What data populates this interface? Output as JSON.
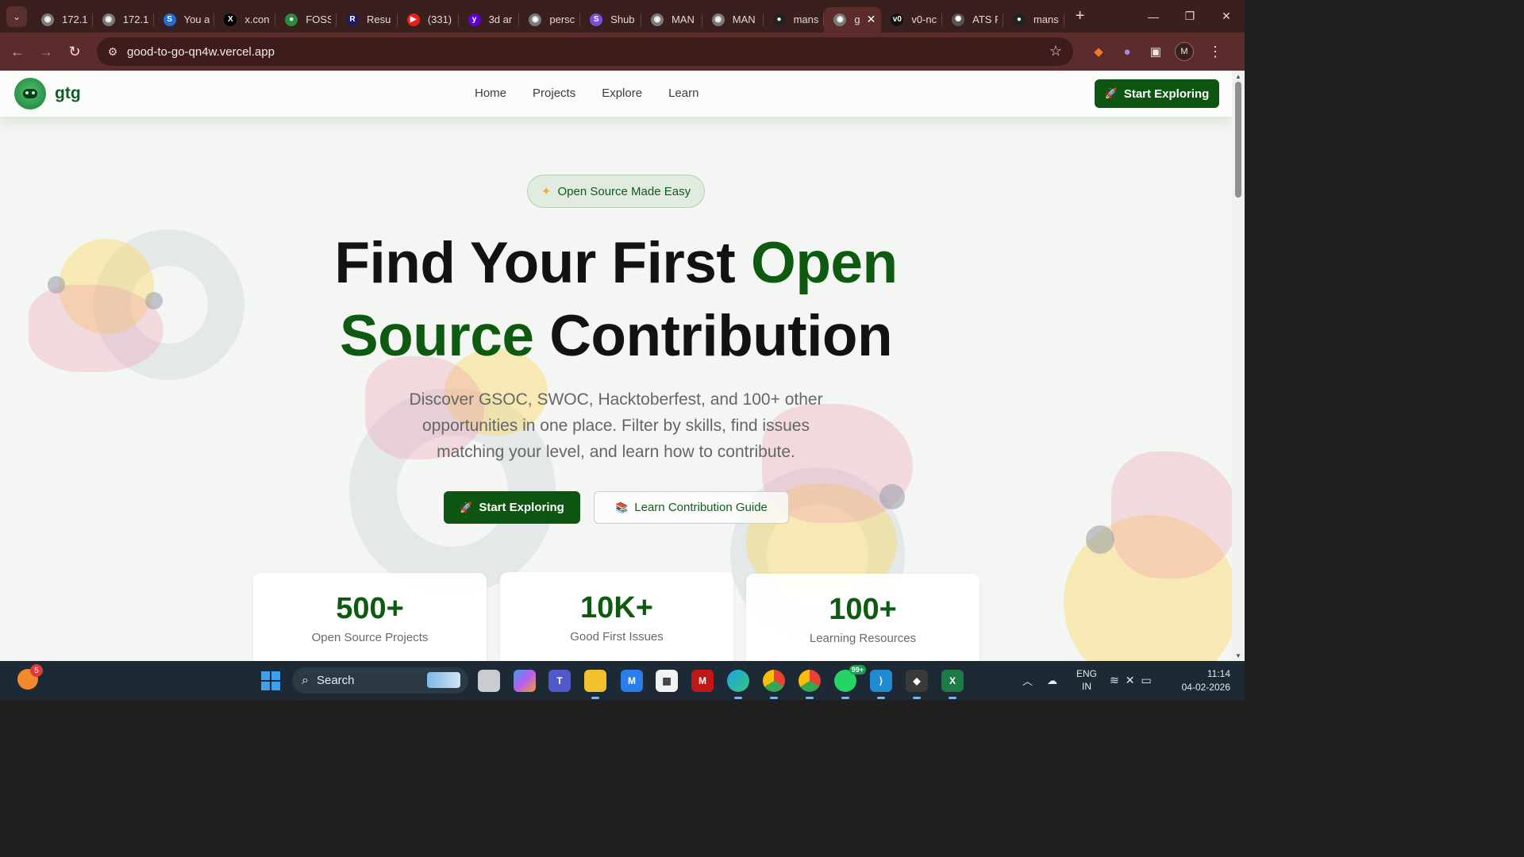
{
  "browser": {
    "tabs": [
      {
        "title": "172.1",
        "icon": "globe-icon",
        "color": "#7a7a7a"
      },
      {
        "title": "172.1",
        "icon": "globe-icon",
        "color": "#7a7a7a"
      },
      {
        "title": "You a",
        "icon": "s-logo-icon",
        "color": "#1f6fd6"
      },
      {
        "title": "x.con",
        "icon": "x-logo-icon",
        "color": "#000000"
      },
      {
        "title": "FOSS",
        "icon": "foss-logo-icon",
        "color": "#2b8a3e"
      },
      {
        "title": "Resu",
        "icon": "r-logo-icon",
        "color": "#1d1d5e"
      },
      {
        "title": "(331)",
        "icon": "youtube-icon",
        "color": "#e62117"
      },
      {
        "title": "3d ar",
        "icon": "yahoo-icon",
        "color": "#6001d2"
      },
      {
        "title": "persc",
        "icon": "globe-icon",
        "color": "#7a7a7a"
      },
      {
        "title": "Shub",
        "icon": "s-circle-icon",
        "color": "#7b4fd6"
      },
      {
        "title": "MAN",
        "icon": "globe-icon",
        "color": "#7a7a7a"
      },
      {
        "title": "MAN",
        "icon": "globe-icon",
        "color": "#7a7a7a"
      },
      {
        "title": "mans",
        "icon": "github-icon",
        "color": "#222222"
      },
      {
        "title": "g",
        "icon": "globe-icon",
        "color": "#7a7a7a",
        "active": true
      },
      {
        "title": "v0-nc",
        "icon": "v0-icon",
        "color": "#111111"
      },
      {
        "title": "ATS F",
        "icon": "openai-icon",
        "color": "#555555"
      },
      {
        "title": "mans",
        "icon": "github-icon",
        "color": "#222222"
      }
    ],
    "new_tab_label": "+",
    "url": "good-to-go-qn4w.vercel.app",
    "profile_initial": "M",
    "window": {
      "minimize": "—",
      "restore": "❐",
      "close": "✕"
    }
  },
  "site": {
    "logo_text": "gtg",
    "nav": [
      "Home",
      "Projects",
      "Explore",
      "Learn"
    ],
    "header_cta": "Start Exploring",
    "badge": "Open Source Made Easy",
    "hero": {
      "line1_dark": "Find Your First ",
      "line1_green": "Open",
      "line2_green": "Source",
      "line2_dark": " Contribution"
    },
    "subtitle": "Discover GSOC, SWOC, Hacktoberfest, and 100+ other opportunities in one place. Filter by skills, find issues matching your level, and learn how to contribute.",
    "primary_button": "Start Exploring",
    "secondary_button": "Learn Contribution Guide",
    "stats": [
      {
        "value": "500+",
        "label": "Open Source Projects"
      },
      {
        "value": "10K+",
        "label": "Good First Issues"
      },
      {
        "value": "100+",
        "label": "Learning Resources"
      }
    ],
    "colors": {
      "brand_green": "#0e5413",
      "accent_green": "#0d5a10"
    }
  },
  "taskbar": {
    "weather_badge": "5",
    "search_placeholder": "Search",
    "whatsapp_badge": "99+",
    "lang_line1": "ENG",
    "lang_line2": "IN",
    "time": "11:14",
    "date": "04-02-2026"
  }
}
